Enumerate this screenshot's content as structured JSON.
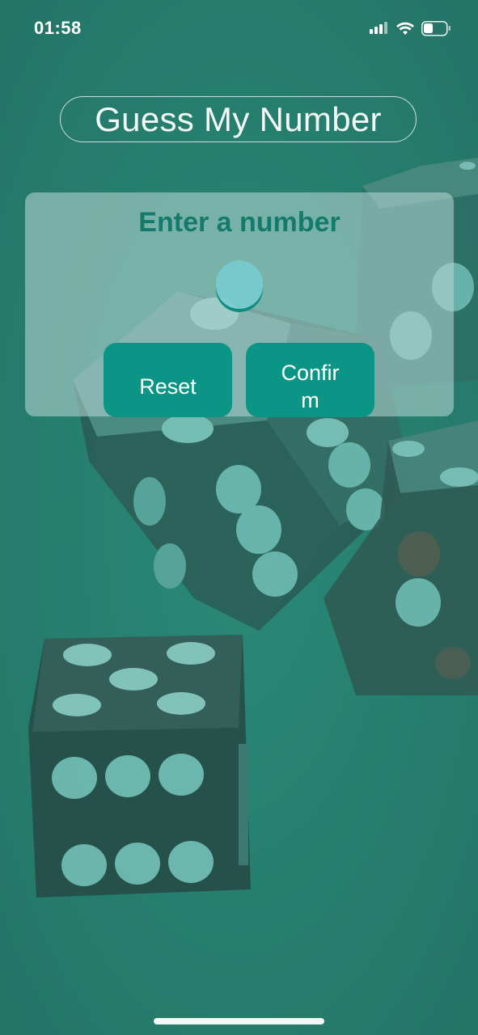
{
  "status_bar": {
    "time": "01:58",
    "icons": [
      "cellular-signal-icon",
      "wifi-icon",
      "battery-icon"
    ]
  },
  "app": {
    "title": "Guess My Number",
    "background_image": "dice-on-green-felt"
  },
  "card": {
    "heading": "Enter a number",
    "input": {
      "value": "",
      "placeholder": ""
    },
    "buttons": {
      "reset_label": "Reset",
      "confirm_label": "Confirm"
    }
  },
  "colors": {
    "accent": "#0a9587",
    "heading": "#147a6c",
    "background": "#27806f",
    "card": "#b4d4d0"
  }
}
